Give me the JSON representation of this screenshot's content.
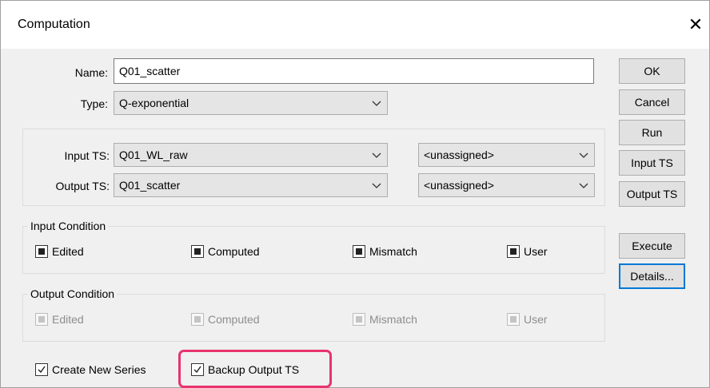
{
  "window": {
    "title": "Computation",
    "close_glyph": "✕"
  },
  "name_field": {
    "label": "Name:",
    "value": "Q01_scatter"
  },
  "type_field": {
    "label": "Type:",
    "value": "Q-exponential"
  },
  "input_ts": {
    "label": "Input TS:",
    "value": "Q01_WL_raw",
    "secondary": "<unassigned>"
  },
  "output_ts": {
    "label": "Output TS:",
    "value": "Q01_scatter",
    "secondary": "<unassigned>"
  },
  "input_condition": {
    "title": "Input Condition",
    "items": [
      {
        "label": "Edited",
        "checked": true
      },
      {
        "label": "Computed",
        "checked": true
      },
      {
        "label": "Mismatch",
        "checked": true
      },
      {
        "label": "User",
        "checked": true
      }
    ]
  },
  "output_condition": {
    "title": "Output Condition",
    "items": [
      {
        "label": "Edited"
      },
      {
        "label": "Computed"
      },
      {
        "label": "Mismatch"
      },
      {
        "label": "User"
      }
    ]
  },
  "options": {
    "create_new_series": {
      "label": "Create New Series",
      "checked": true
    },
    "backup_output_ts": {
      "label": "Backup Output TS",
      "checked": true
    }
  },
  "buttons": {
    "ok": "OK",
    "cancel": "Cancel",
    "run": "Run",
    "input_ts": "Input TS",
    "output_ts": "Output TS",
    "execute": "Execute",
    "details": "Details..."
  },
  "colors": {
    "highlight": "#e8336e",
    "focus": "#0078d7"
  }
}
